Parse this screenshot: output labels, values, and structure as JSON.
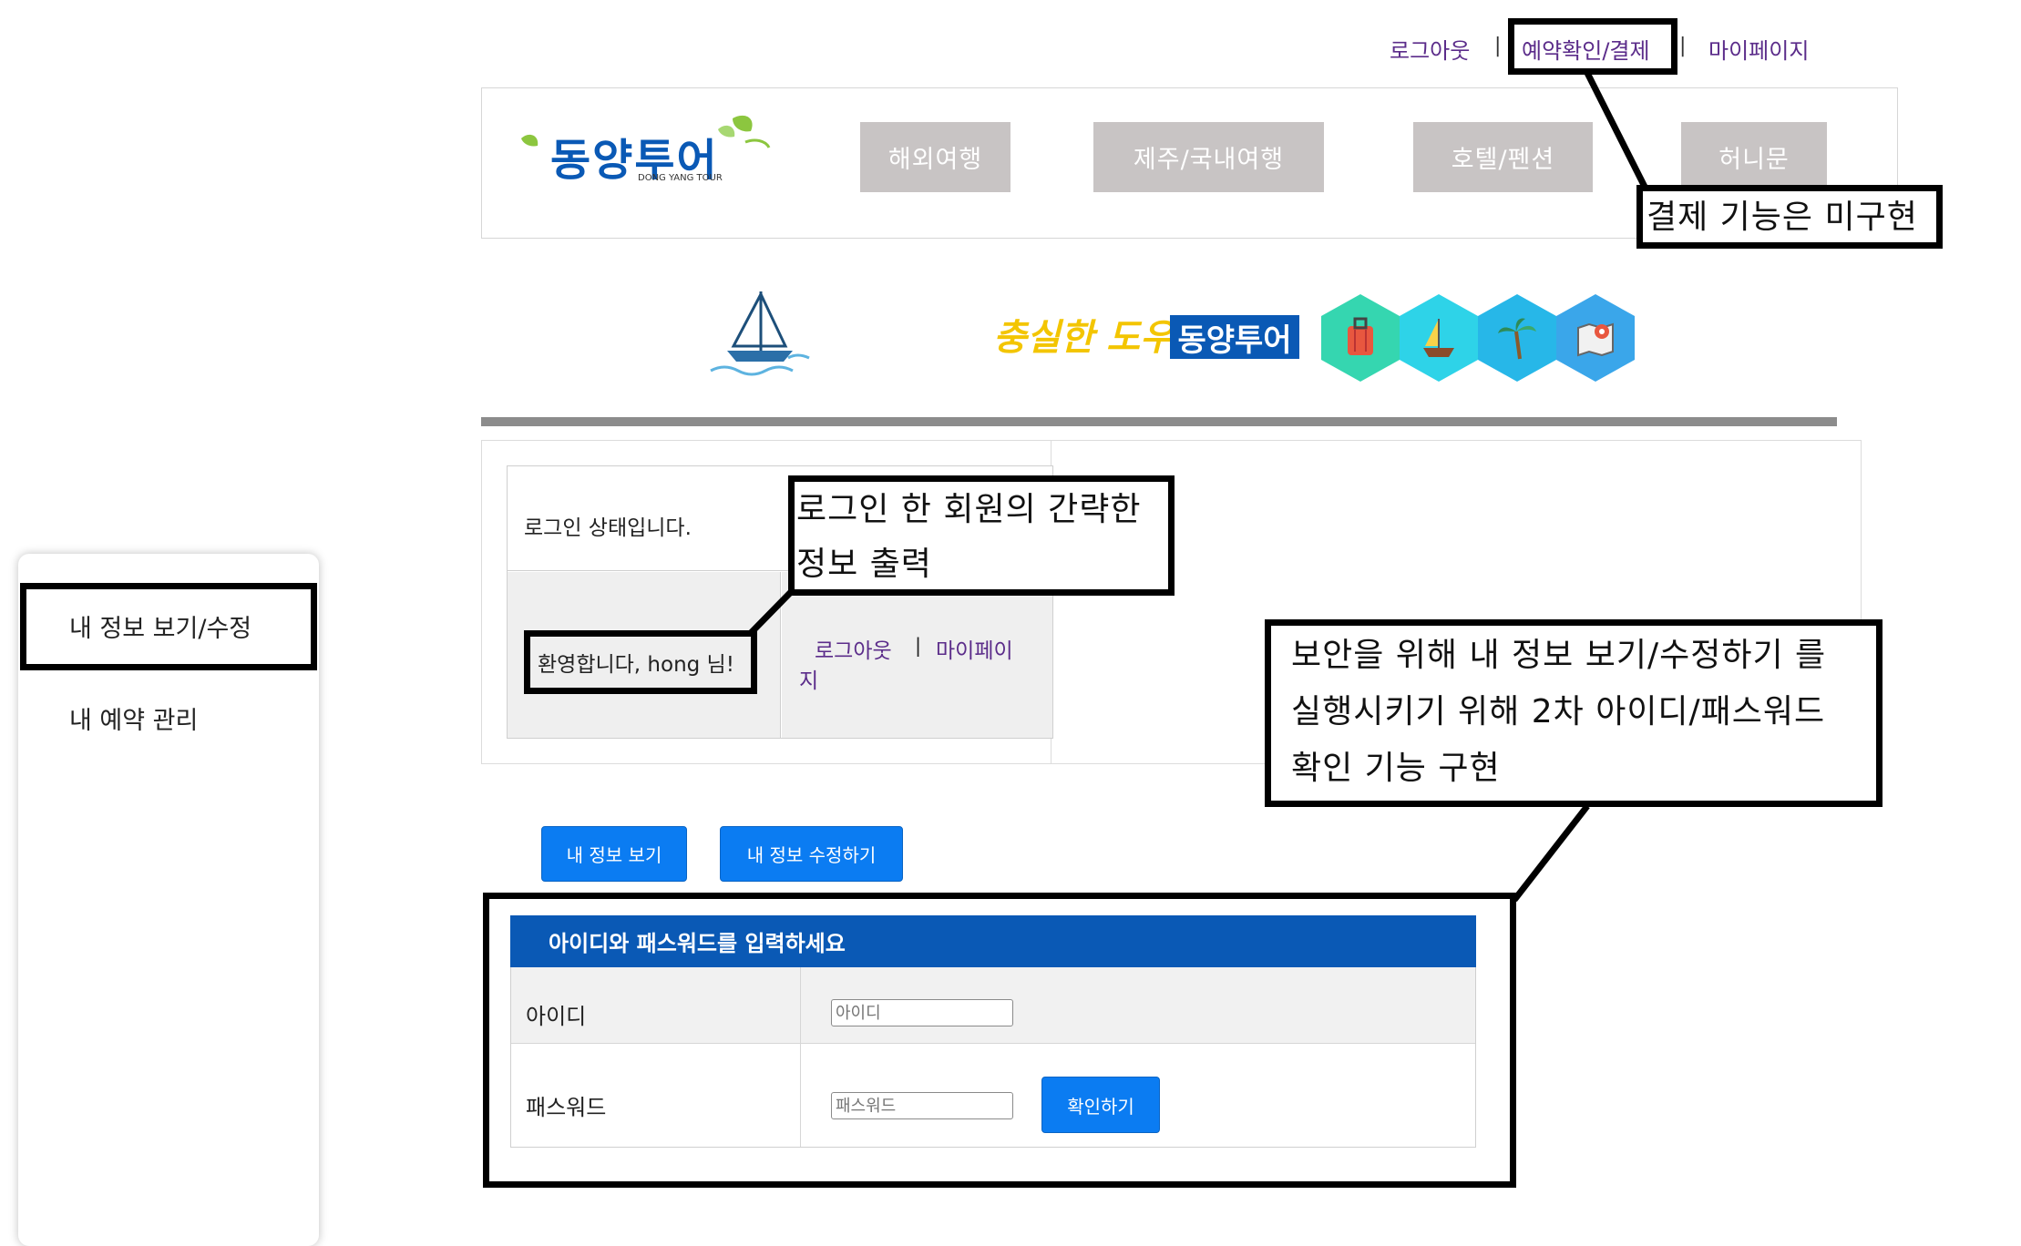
{
  "top_links": {
    "logout": "로그아웃",
    "reservation": "예약확인/결제",
    "mypage": "마이페이지",
    "sep": "|"
  },
  "logo": {
    "main": "동양투어",
    "sub": "DONG YANG TOUR"
  },
  "nav": [
    "해외여행",
    "제주/국내여행",
    "호텔/펜션",
    "허니문"
  ],
  "banner": {
    "slogan": "충실한 도우미",
    "brand": "동양투어"
  },
  "login_status": {
    "status_text": "로그인 상태입니다.",
    "welcome": "환영합니다, hong 님!",
    "logout": "로그아웃",
    "mypage_line1": "마이페이",
    "mypage_line2": "지",
    "sep": "|"
  },
  "sidebar": {
    "items": [
      "내 정보 보기/수정",
      "내 예약 관리"
    ]
  },
  "actions": {
    "view_info": "내 정보 보기",
    "edit_info": "내 정보 수정하기"
  },
  "auth_form": {
    "title": "아이디와 패스워드를 입력하세요",
    "id_label": "아이디",
    "id_placeholder": "아이디",
    "pw_label": "패스워드",
    "pw_placeholder": "패스워드",
    "confirm": "확인하기"
  },
  "annotations": {
    "payment_note": "결제 기능은 미구현",
    "login_note_line1": "로그인 한 회원의 간략한",
    "login_note_line2": "정보 출력",
    "security_note_line1": "보안을 위해 내 정보 보기/수정하기 를",
    "security_note_line2": "실행시키기 위해 2차 아이디/패스워드",
    "security_note_line3": "확인 기능 구현"
  },
  "colors": {
    "link": "#5b2c8a",
    "nav_bg": "#c8c4c4",
    "primary_button": "#0b7cf2",
    "form_header": "#0a59b5",
    "divider": "#8c8c8c"
  }
}
